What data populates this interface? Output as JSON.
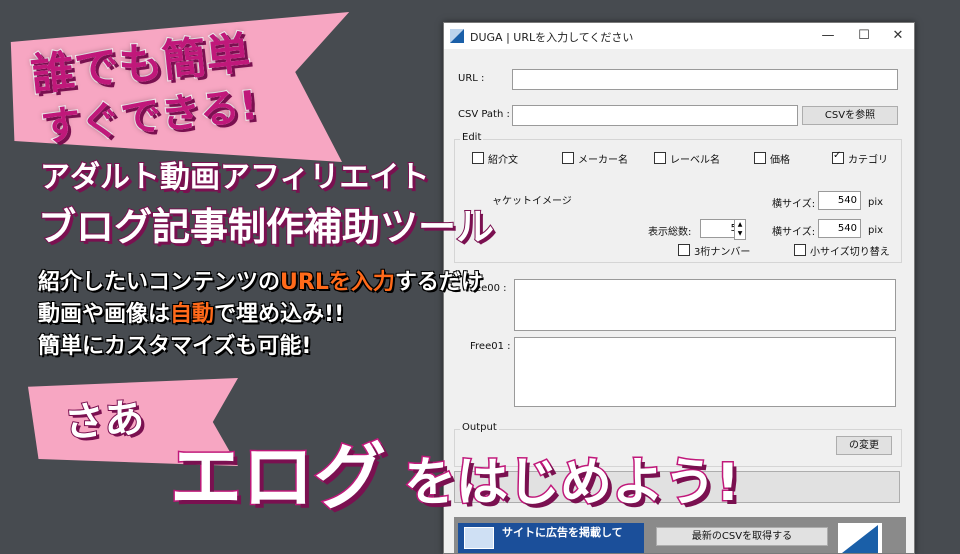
{
  "window": {
    "title": "DUGA | URLを入力してください",
    "controls": {
      "minimize": "—",
      "maximize": "☐",
      "close": "✕"
    }
  },
  "form": {
    "url_label": "URL :",
    "url_value": "",
    "csv_label": "CSV Path :",
    "csv_value": "",
    "csv_button": "CSVを参照"
  },
  "edit": {
    "group_title": "Edit",
    "checkboxes": [
      {
        "label": "紹介文",
        "checked": false
      },
      {
        "label": "メーカー名",
        "checked": false
      },
      {
        "label": "レーベル名",
        "checked": false
      },
      {
        "label": "価格",
        "checked": false
      },
      {
        "label": "カテゴリ",
        "checked": true
      }
    ],
    "jacket_label": "ャケットイメージ",
    "width_label_1": "横サイズ:",
    "width_value_1": "540",
    "unit_1": "pix",
    "total_label": "表示総数:",
    "total_value": "5",
    "width_label_2": "横サイズ:",
    "width_value_2": "540",
    "unit_2": "pix",
    "three_digit": "3桁ナンバー",
    "small_size": "小サイズ切り替え"
  },
  "free": {
    "free00_label": "Free00 :",
    "free01_label": "Free01 :"
  },
  "output": {
    "group_title": "Output",
    "change_button": "の変更"
  },
  "bottom": {
    "banner_text": "サイトに広告を掲載して",
    "latest_csv_button": "最新のCSVを取得する"
  },
  "promo": {
    "badge_line1": "誰でも簡単",
    "badge_line2": "すぐできる!",
    "headline1": "アダルト動画アフィリエイト",
    "headline2": "ブログ記事制作補助ツール",
    "line1_pre": "紹介したいコンテンツの",
    "line1_hl": "URLを入力",
    "line1_post": "するだけ",
    "line2_pre": "動画や画像は",
    "line2_hl": "自動",
    "line2_post": "で埋め込み!!",
    "line3": "簡単にカスタマイズも可能!",
    "saa": "さあ",
    "cta_part1": "エログ",
    "cta_part2": "をはじめよう!"
  }
}
